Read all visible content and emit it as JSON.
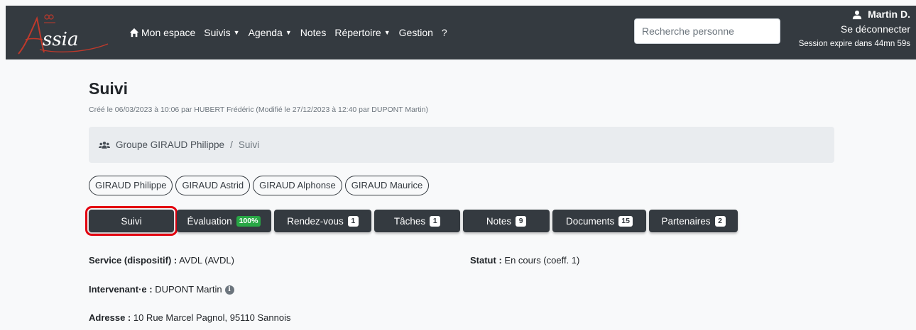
{
  "navbar": {
    "logo_text": "Assia",
    "items": [
      {
        "label": "Mon espace",
        "icon": "home-icon",
        "dropdown": false
      },
      {
        "label": "Suivis",
        "dropdown": true
      },
      {
        "label": "Agenda",
        "dropdown": true
      },
      {
        "label": "Notes",
        "dropdown": false
      },
      {
        "label": "Répertoire",
        "dropdown": true
      },
      {
        "label": "Gestion",
        "dropdown": false
      },
      {
        "label": "?",
        "dropdown": false
      }
    ],
    "search_placeholder": "Recherche personne",
    "user_name": "Martin D.",
    "logout_label": "Se déconnecter",
    "session_text": "Session expire dans 44mn 59s"
  },
  "page": {
    "title": "Suivi",
    "created_text": "Créé le 06/03/2023 à 10:06 par HUBERT Frédéric (Modifié le 27/12/2023 à 12:40 par DUPONT Martin)",
    "breadcrumb": {
      "group": "Groupe GIRAUD Philippe",
      "separator": "/",
      "current": "Suivi"
    },
    "people": [
      "GIRAUD Philippe",
      "GIRAUD Astrid",
      "GIRAUD Alphonse",
      "GIRAUD Maurice"
    ],
    "tabs": [
      {
        "label": "Suivi",
        "badge": null
      },
      {
        "label": "Évaluation",
        "badge": "100%"
      },
      {
        "label": "Rendez-vous",
        "badge": "1"
      },
      {
        "label": "Tâches",
        "badge": "1"
      },
      {
        "label": "Notes",
        "badge": "9"
      },
      {
        "label": "Documents",
        "badge": "15"
      },
      {
        "label": "Partenaires",
        "badge": "2"
      }
    ],
    "fields": {
      "service_label": "Service (dispositif) :",
      "service_value": " AVDL (AVDL)",
      "statut_label": "Statut :",
      "statut_value": " En cours (coeff. 1)",
      "intervenant_label": "Intervenant·e :",
      "intervenant_value": " DUPONT Martin",
      "adresse_label": "Adresse :",
      "adresse_value": " 10 Rue Marcel Pagnol, 95110 Sannois"
    }
  },
  "colors": {
    "navbar": "#343a40",
    "highlight": "#e3000f",
    "badge_green": "#28a745",
    "logo_red": "#c0392b"
  }
}
